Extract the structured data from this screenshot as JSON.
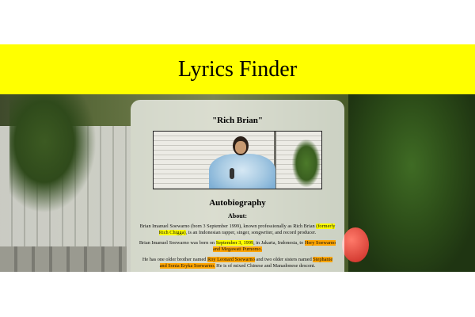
{
  "header": {
    "title": "Lyrics Finder"
  },
  "card": {
    "artist_name": "\"Rich Brian\"",
    "section_title": "Autobiography",
    "about_label": "About:",
    "paragraphs": [
      {
        "parts": [
          {
            "text": "Brian Imanuel Soewarno (born 3 September 1999), known professionally as Rich Brian ",
            "highlight": ""
          },
          {
            "text": "(formerly Rich Chigga)",
            "highlight": "yellow"
          },
          {
            "text": ", is an Indonesian rapper, singer, songwriter, and record producer.",
            "highlight": ""
          }
        ]
      },
      {
        "parts": [
          {
            "text": "Brian Imanuel Soewarno was born on ",
            "highlight": ""
          },
          {
            "text": "September 3, 1999",
            "highlight": "yellow"
          },
          {
            "text": ", in Jakarta, Indonesia, to ",
            "highlight": ""
          },
          {
            "text": "Hery Soewarno and Megawati Purnomo.",
            "highlight": "orange"
          }
        ]
      },
      {
        "parts": [
          {
            "text": "He has one older brother named ",
            "highlight": ""
          },
          {
            "text": "Roy Leonard Soewarno",
            "highlight": "orange"
          },
          {
            "text": " and two older sisters named ",
            "highlight": ""
          },
          {
            "text": "Stephanie and Sonia Eryka Soewarno.",
            "highlight": "orange"
          },
          {
            "text": " He is of mixed Chinese and Manadonese descent.",
            "highlight": ""
          }
        ]
      }
    ]
  },
  "colors": {
    "header_bg": "#ffff00",
    "highlight_yellow": "#ffff00",
    "highlight_orange": "#ffa500"
  },
  "icons": {
    "artist_photo": "person-photo"
  }
}
